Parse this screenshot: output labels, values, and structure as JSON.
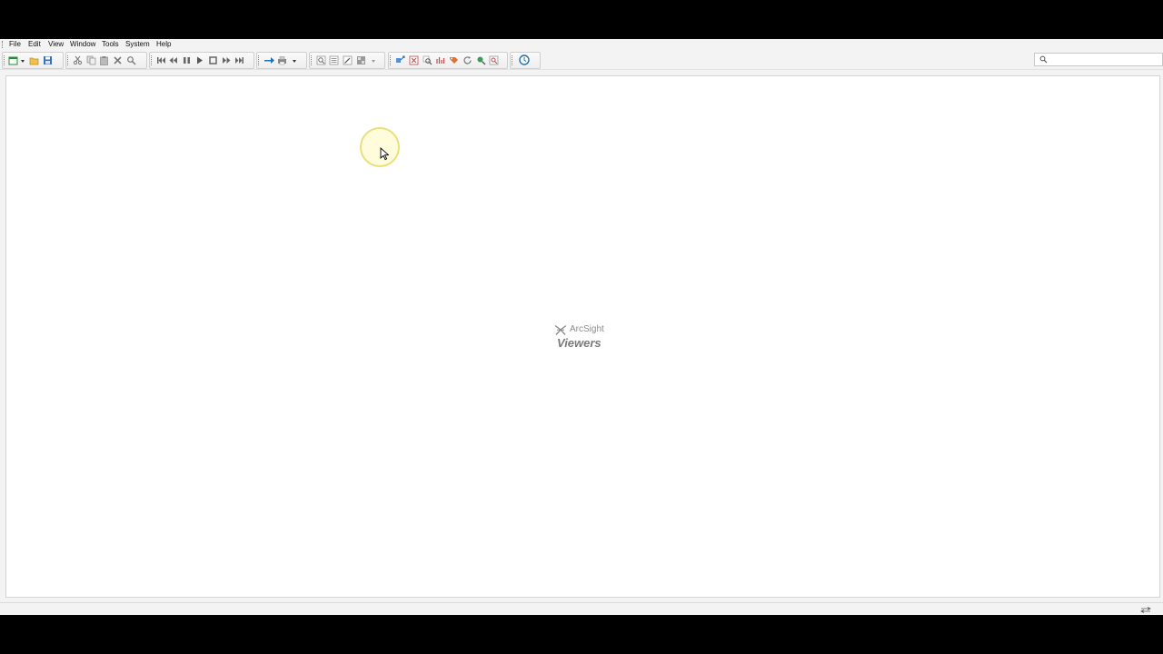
{
  "menubar": {
    "items": [
      {
        "label": "File"
      },
      {
        "label": "Edit"
      },
      {
        "label": "View"
      },
      {
        "label": "Window"
      },
      {
        "label": "Tools"
      },
      {
        "label": "System"
      },
      {
        "label": "Help"
      }
    ]
  },
  "toolbar": {
    "groups": [
      {
        "name": "file-group",
        "icons": [
          "new-icon",
          "open-folder-icon",
          "save-icon"
        ]
      },
      {
        "name": "edit-group",
        "icons": [
          "cut-icon",
          "copy-icon",
          "paste-icon",
          "delete-icon",
          "find-icon"
        ]
      },
      {
        "name": "playback-group",
        "icons": [
          "first-icon",
          "rewind-icon",
          "pause-icon",
          "play-icon",
          "stop-icon",
          "fast-forward-icon",
          "last-icon"
        ]
      },
      {
        "name": "send-group",
        "icons": [
          "send-icon",
          "print-icon"
        ]
      },
      {
        "name": "view-group",
        "icons": [
          "zoom-view-icon",
          "list-view-icon",
          "edit-view-icon",
          "grid-view-icon"
        ]
      },
      {
        "name": "tools-group",
        "icons": [
          "inspect-icon",
          "filter-icon",
          "zoom-icon",
          "signal-icon",
          "tag-icon",
          "refresh-icon",
          "search-globe-icon",
          "image-search-icon"
        ]
      },
      {
        "name": "time-group",
        "icons": [
          "clock-icon"
        ]
      }
    ],
    "search": {
      "placeholder": "",
      "value": "",
      "icon": "magnifier-icon"
    }
  },
  "brand": {
    "name": "ArcSight",
    "product": "Viewers"
  },
  "colors": {
    "background": "#f3f3f3",
    "panel": "#ffffff",
    "accent": "#1f6fb5",
    "cursor_highlight": "#e8e07a"
  }
}
